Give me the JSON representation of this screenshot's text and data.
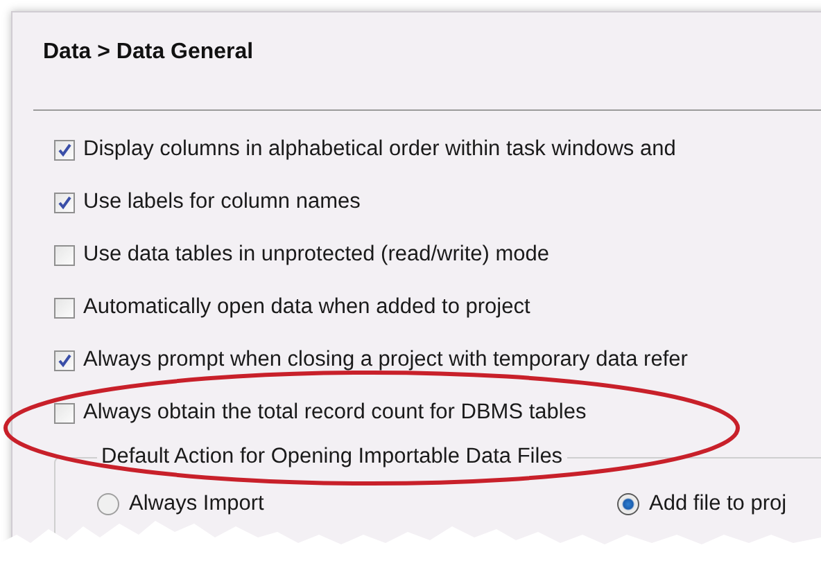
{
  "panel": {
    "title": "Data > Data General"
  },
  "options": [
    {
      "label": "Display columns in alphabetical order within task windows and",
      "checked": true
    },
    {
      "label": "Use labels for column names",
      "checked": true
    },
    {
      "label": "Use data tables in unprotected (read/write) mode",
      "checked": false
    },
    {
      "label": "Automatically open data when added to project",
      "checked": false
    },
    {
      "label": "Always prompt when closing a project with temporary data refer",
      "checked": true
    },
    {
      "label": "Always obtain the total record count for DBMS tables",
      "checked": false
    }
  ],
  "default_action": {
    "legend": "Default Action for Opening Importable Data Files",
    "choices": [
      {
        "label": "Always Import",
        "selected": false
      },
      {
        "label": "Add file to proj",
        "selected": true
      }
    ]
  }
}
